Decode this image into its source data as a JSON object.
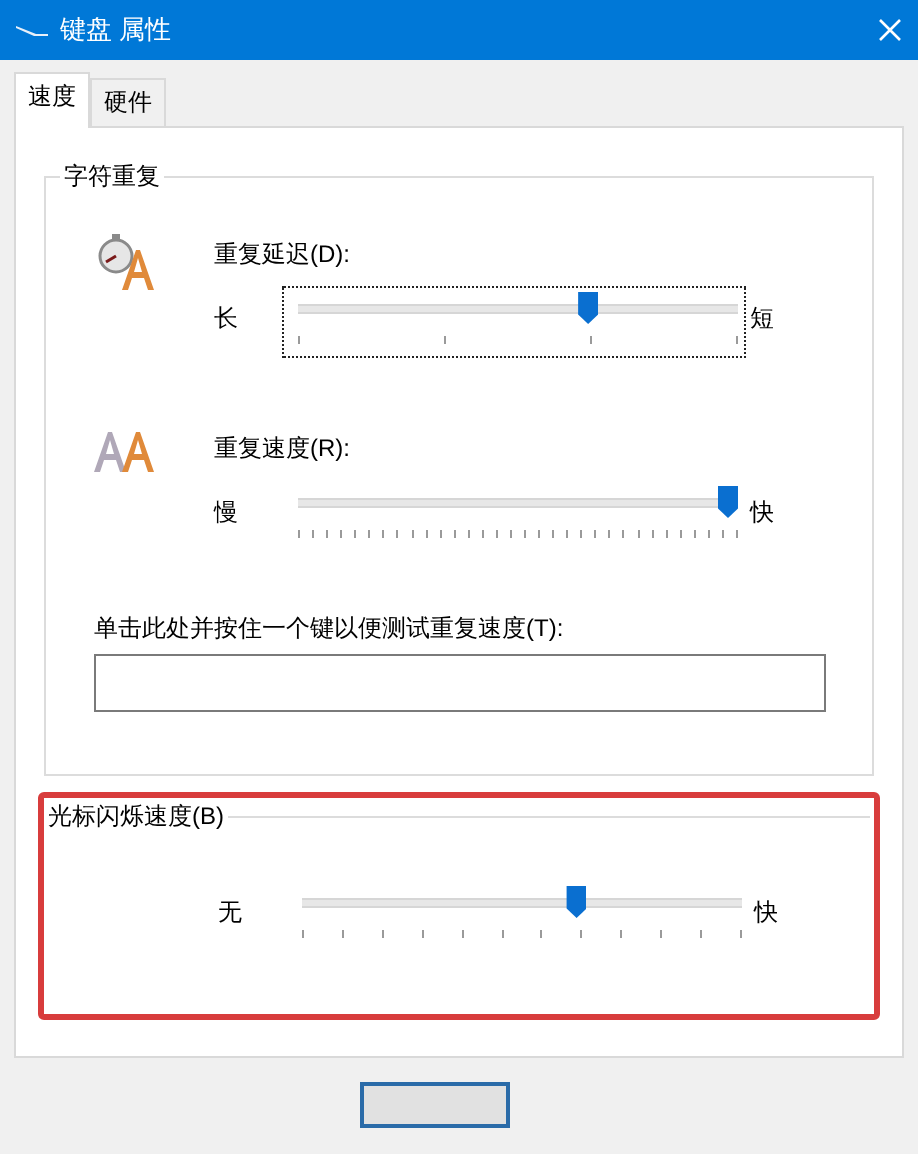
{
  "window": {
    "title": "键盘 属性"
  },
  "tabs": [
    {
      "label": "速度",
      "selected": true
    },
    {
      "label": "硬件",
      "selected": false
    }
  ],
  "char_repeat": {
    "title": "字符重复",
    "sliders": [
      {
        "kind": "delay",
        "label": "重复延迟(D):",
        "left": "长",
        "right": "短",
        "level": 0.667,
        "focused": true
      },
      {
        "kind": "rate",
        "label": "重复速度(R):",
        "left": "慢",
        "right": "快",
        "level": 1.0,
        "focused": false
      }
    ],
    "test": {
      "label": "单击此处并按住一个键以便测试重复速度(T):"
    }
  },
  "cursor_blink": {
    "title": "光标闪烁速度(B)",
    "highlighted": true,
    "left": "无",
    "right": "快",
    "level": 0.63
  },
  "buttons": [
    {
      "default": true
    }
  ]
}
